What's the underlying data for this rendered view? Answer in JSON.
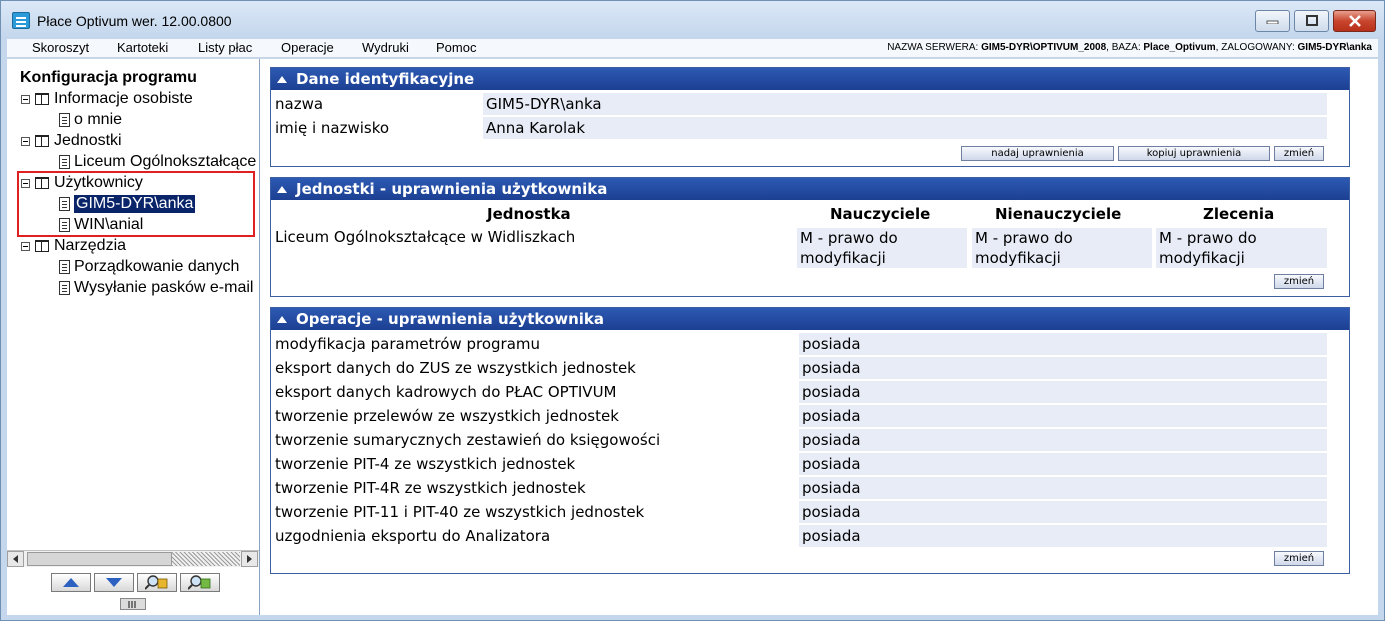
{
  "window": {
    "title": "Płace Optivum wer. 12.00.0800"
  },
  "menu": [
    "Skoroszyt",
    "Kartoteki",
    "Listy płac",
    "Operacje",
    "Wydruki",
    "Pomoc"
  ],
  "server_info": {
    "server_label": "NAZWA SERWERA: ",
    "server_value": "GIM5-DYR\\OPTIVUM_2008",
    "db_label": ", BAZA: ",
    "db_value": "Place_Optivum",
    "user_label": ", ZALOGOWANY: ",
    "user_value": "GIM5-DYR\\anka"
  },
  "tree": {
    "title": "Konfiguracja programu",
    "groups": [
      {
        "label": "Informacje osobiste",
        "children": [
          "o mnie"
        ]
      },
      {
        "label": "Jednostki",
        "children": [
          "Liceum Ogólnokształcące w Widliszkach"
        ]
      },
      {
        "label": "Użytkownicy",
        "children": [
          "GIM5-DYR\\anka",
          "WIN\\anial"
        ]
      },
      {
        "label": "Narzędzia",
        "children": [
          "Porządkowanie danych",
          "Wysyłanie pasków e-mail"
        ]
      }
    ],
    "selected": "GIM5-DYR\\anka"
  },
  "dane": {
    "header": "Dane identyfikacyjne",
    "rows": [
      {
        "label": "nazwa",
        "value": "GIM5-DYR\\anka"
      },
      {
        "label": "imię i nazwisko",
        "value": "Anna Karolak"
      }
    ],
    "buttons": {
      "grant": "nadaj uprawnienia",
      "copy": "kopiuj uprawnienia",
      "change": "zmień"
    }
  },
  "jednostki": {
    "header": "Jednostki - uprawnienia użytkownika",
    "columns": [
      "Jednostka",
      "Nauczyciele",
      "Nienauczyciele",
      "Zlecenia"
    ],
    "row": {
      "unit": "Liceum Ogólnokształcące w Widliszkach",
      "nauczyciele": "M - prawo do modyfikacji",
      "nienauczyciele": "M - prawo do modyfikacji",
      "zlecenia": "M - prawo do modyfikacji"
    },
    "change": "zmień"
  },
  "operacje": {
    "header": "Operacje - uprawnienia użytkownika",
    "rows": [
      {
        "label": "modyfikacja parametrów programu",
        "value": "posiada"
      },
      {
        "label": "eksport danych do ZUS ze wszystkich jednostek",
        "value": "posiada"
      },
      {
        "label": "eksport danych kadrowych do PŁAC OPTIVUM",
        "value": "posiada"
      },
      {
        "label": "tworzenie przelewów ze wszystkich jednostek",
        "value": "posiada"
      },
      {
        "label": "tworzenie sumarycznych zestawień do księgowości",
        "value": "posiada"
      },
      {
        "label": "tworzenie PIT-4 ze wszystkich jednostek",
        "value": "posiada"
      },
      {
        "label": "tworzenie PIT-4R ze wszystkich jednostek",
        "value": "posiada"
      },
      {
        "label": "tworzenie PIT-11 i PIT-40 ze wszystkich jednostek",
        "value": "posiada"
      },
      {
        "label": "uzgodnienia eksportu do Analizatora",
        "value": "posiada"
      }
    ],
    "change": "zmień"
  },
  "colors": {
    "section_header": "#2d5ab3",
    "value_bg": "#e8ecf7",
    "selection": "#0a246a",
    "highlight": "#e02020"
  }
}
